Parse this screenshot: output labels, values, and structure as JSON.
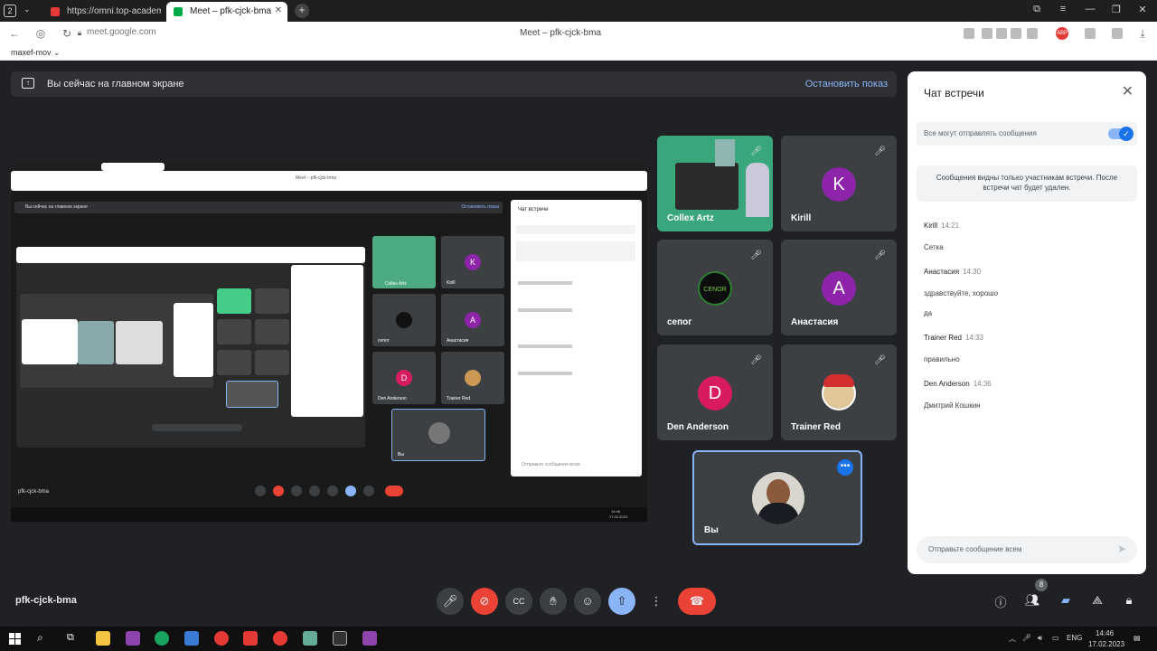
{
  "browser": {
    "tab_count_badge": "2",
    "tabs": [
      {
        "label": "https://omni.top-academy",
        "active": false,
        "icon": "academy-icon"
      },
      {
        "label": "Meet – pfk-cjck-bma",
        "active": true,
        "icon": "meet-icon"
      }
    ],
    "new_tab_label": "+",
    "url": "meet.google.com",
    "window_title": "Meet – pfk-cjck-bma",
    "profile": "maxef-mov",
    "adblock_badge": "ABP"
  },
  "banner": {
    "text": "Вы сейчас на главном экране",
    "stop_label": "Остановить показ"
  },
  "presentation": {
    "inner_title": "Meet – pfk-cjck-bma",
    "inner_banner": "Вы сейчас на главном экране",
    "inner_stop": "Остановить показ",
    "inner_chat_title": "Чат встречи",
    "inner_meeting_code": "pfk-cjck-bma",
    "inner_chat_input": "Отправьте сообщение всем",
    "inner_you": "Вы",
    "inner_tiles": [
      "Collex Artz",
      "Kirill",
      "сепог",
      "Анастасия",
      "Den Anderson",
      "Trainer Red"
    ],
    "inner_time": "14:46",
    "inner_date": "17.02.2023"
  },
  "participants": [
    {
      "name": "Collex Artz",
      "type": "video",
      "muted": true
    },
    {
      "name": "Kirill",
      "letter": "K",
      "color": "#8e24aa",
      "muted": true
    },
    {
      "name": "сепог",
      "type": "image",
      "muted": true
    },
    {
      "name": "Анастасия",
      "letter": "A",
      "color": "#8e24aa",
      "muted": true
    },
    {
      "name": "Den Anderson",
      "letter": "D",
      "color": "#d81b60",
      "muted": true
    },
    {
      "name": "Trainer Red",
      "type": "image",
      "muted": true
    }
  ],
  "self_tile": {
    "name": "Вы",
    "more_icon": "more-options-icon"
  },
  "chat": {
    "title": "Чат встречи",
    "allow_label": "Все могут отправлять сообщения",
    "notice": "Сообщения видны только участникам встречи. После встречи чат будет удален.",
    "messages": [
      {
        "author": "Kirill",
        "time": "14:21",
        "lines": [
          "Сетка"
        ]
      },
      {
        "author": "Анастасия",
        "time": "14:30",
        "lines": [
          "здравствуйте, хорошо",
          "да"
        ]
      },
      {
        "author": "Trainer Red",
        "time": "14:33",
        "lines": [
          "правильно"
        ]
      },
      {
        "author": "Den Anderson",
        "time": "14:36",
        "lines": [
          "Дмитрий Кошкин"
        ]
      }
    ],
    "input_placeholder": "Отправьте сообщение всем"
  },
  "meeting_code": "pfk-cjck-bma",
  "controls": {
    "people_badge": "8"
  },
  "taskbar": {
    "lang": "ENG",
    "time": "14:46",
    "date": "17.02.2023"
  },
  "colors": {
    "meet_bg": "#202124",
    "tile_bg": "#3c4043",
    "accent": "#8ab4f8",
    "danger": "#ea4335"
  }
}
